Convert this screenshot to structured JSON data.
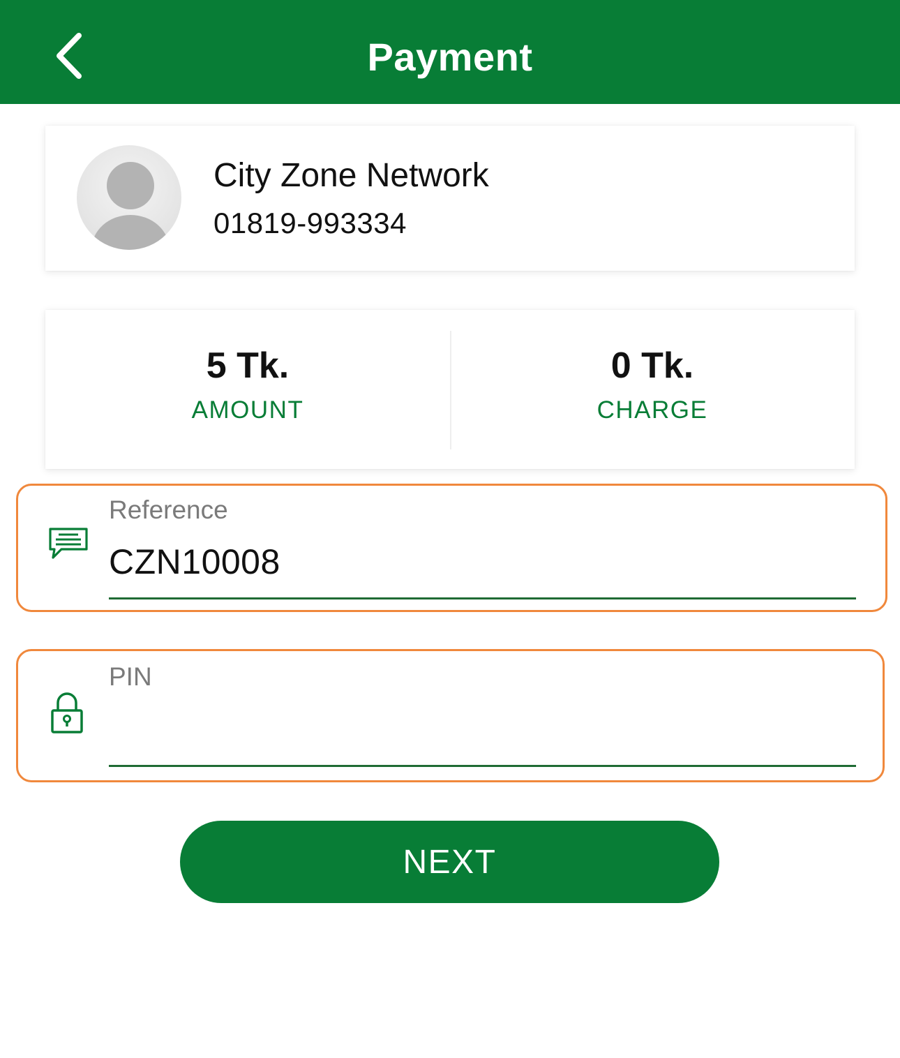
{
  "header": {
    "title": "Payment",
    "back_icon": "chevron-left-icon"
  },
  "merchant": {
    "name": "City Zone Network",
    "phone": "01819-993334",
    "avatar_icon": "user-avatar-icon"
  },
  "summary": {
    "amount_value": "5 Tk.",
    "amount_label": "AMOUNT",
    "charge_value": "0 Tk.",
    "charge_label": "CHARGE"
  },
  "reference_field": {
    "label": "Reference",
    "value": "CZN10008",
    "icon": "message-icon"
  },
  "pin_field": {
    "label": "PIN",
    "value": "",
    "icon": "lock-icon"
  },
  "next_button": {
    "label": "NEXT"
  },
  "colors": {
    "brand_green": "#087D36",
    "highlight_orange": "#F0883C",
    "label_gray": "#7a7a7a"
  }
}
